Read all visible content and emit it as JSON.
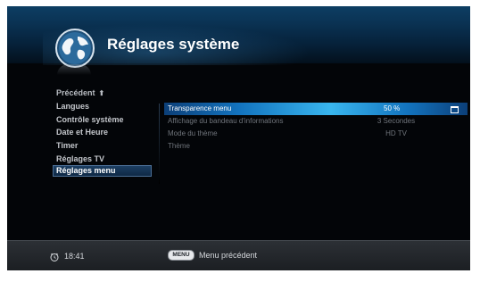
{
  "header": {
    "title": "Réglages système",
    "logo_icon": "globe-logo-icon"
  },
  "menu": {
    "back_label": "Précédent",
    "back_icon": "up-arrow-icon",
    "items": [
      {
        "label": "Langues"
      },
      {
        "label": "Contrôle système"
      },
      {
        "label": "Date et Heure"
      },
      {
        "label": "Timer"
      },
      {
        "label": "Réglages TV"
      },
      {
        "label": "Réglages menu",
        "selected": true
      }
    ]
  },
  "settings": [
    {
      "label": "Transparence menu",
      "value": "50 %",
      "highlighted": true
    },
    {
      "label": "Affichage du bandeau d'informations",
      "value": "3 Secondes"
    },
    {
      "label": "Mode du thème",
      "value": "HD TV"
    },
    {
      "label": "Thème",
      "value": ""
    }
  ],
  "footer": {
    "time": "18:41",
    "clock_icon": "clock-icon",
    "menu_key": "MENU",
    "menu_hint": "Menu précédent"
  },
  "colors": {
    "header_blue": "#0a3253",
    "highlight_blue": "#39b6ee",
    "background": "#030508",
    "footer_gray": "#2c3035"
  }
}
